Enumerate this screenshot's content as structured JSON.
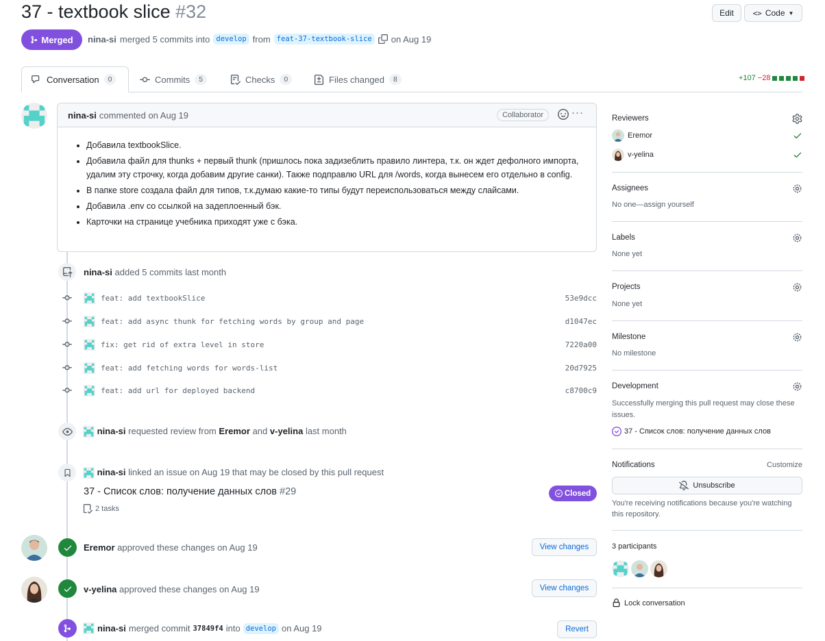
{
  "pr": {
    "title": "37 - textbook slice",
    "number": "#32",
    "edit_label": "Edit",
    "code_label": "Code",
    "state_label": "Merged",
    "author": "nina-si",
    "merge_text": "merged 5 commits into",
    "base_branch": "develop",
    "from_text": "from",
    "head_branch": "feat-37-textbook-slice",
    "date_text": "on Aug 19"
  },
  "tabs": [
    {
      "label": "Conversation",
      "count": "0"
    },
    {
      "label": "Commits",
      "count": "5"
    },
    {
      "label": "Checks",
      "count": "0"
    },
    {
      "label": "Files changed",
      "count": "8"
    }
  ],
  "diffstat": {
    "added": "+107",
    "removed": "−28"
  },
  "comment": {
    "author": "nina-si",
    "meta": "commented on Aug 19",
    "role": "Collaborator",
    "items": [
      "Добавила textbookSlice.",
      "Добавила файл для thunks + первый thunk (пришлось пока задизеблить правило линтера, т.к. он ждет дефолного импорта, удалим эту строчку, когда добавим другие санки). Также подправлю URL для /words, когда вынесем его отдельно в config.",
      "В папке store создала файл для типов, т.к.думаю какие-то типы будут переиспользоваться между слайсами.",
      "Добавила .env со ссылкой на задеплоенный бэк.",
      "Карточки на странице учебника приходят уже с бэка."
    ]
  },
  "commits_event": {
    "author": "nina-si",
    "text": "added 5 commits last month"
  },
  "commits": [
    {
      "message": "feat: add textbookSlice",
      "sha": "53e9dcc"
    },
    {
      "message": "feat: add async thunk for fetching words by group and page",
      "sha": "d1047ec"
    },
    {
      "message": "fix: get rid of extra level in store",
      "sha": "7220a00"
    },
    {
      "message": "feat: add fetching words for words-list",
      "sha": "20d7925"
    },
    {
      "message": "feat: add url for deployed backend",
      "sha": "c8700c9"
    }
  ],
  "review_request": {
    "author": "nina-si",
    "text1": "requested review from",
    "r1": "Eremor",
    "and": "and",
    "r2": "v-yelina",
    "when": "last month"
  },
  "linked": {
    "author": "nina-si",
    "text": "linked an issue on Aug 19 that may be closed by this pull request",
    "issue_title": "37 - Список слов: получение данных слов",
    "issue_number": "#29",
    "issue_state": "Closed",
    "tasks": "2 tasks"
  },
  "approvals": [
    {
      "author": "Eremor",
      "text": "approved these changes on Aug 19",
      "button": "View changes"
    },
    {
      "author": "v-yelina",
      "text": "approved these changes on Aug 19",
      "button": "View changes"
    }
  ],
  "merged_event": {
    "author": "nina-si",
    "text1": "merged commit",
    "sha": "37849f4",
    "into": "into",
    "branch": "develop",
    "when": "on Aug 19",
    "button": "Revert"
  },
  "sidebar": {
    "reviewers_title": "Reviewers",
    "reviewers": [
      "Eremor",
      "v-yelina"
    ],
    "assignees_title": "Assignees",
    "assignees_value": "No one—assign yourself",
    "labels_title": "Labels",
    "labels_value": "None yet",
    "projects_title": "Projects",
    "projects_value": "None yet",
    "milestone_title": "Milestone",
    "milestone_value": "No milestone",
    "development_title": "Development",
    "development_text": "Successfully merging this pull request may close these issues.",
    "development_issue": "37 - Список слов: получение данных слов",
    "notifications_title": "Notifications",
    "customize_label": "Customize",
    "unsubscribe_label": "Unsubscribe",
    "notifications_text": "You're receiving notifications because you're watching this repository.",
    "participants_title": "3 participants",
    "lock_label": "Lock conversation"
  },
  "colors": {
    "merged": "#8250df",
    "approved": "#1f883d",
    "link": "#0969da",
    "identicon": "#54d1c9"
  }
}
